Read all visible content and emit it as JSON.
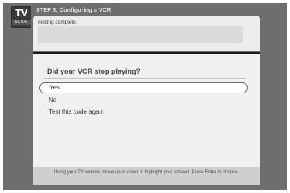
{
  "header": {
    "logo_top": "TV",
    "logo_bottom": "GUIDE",
    "step_title": "STEP 5: Configuring a VCR"
  },
  "status": {
    "text": "Testing complete."
  },
  "prompt": {
    "question": "Did your VCR stop playing?",
    "options": [
      "Yes",
      "No",
      "Test this code again"
    ],
    "selected_index": 0
  },
  "footer": {
    "hint": "Using your TV remote, move up or down to highlight your answer. Press Enter to choose."
  }
}
